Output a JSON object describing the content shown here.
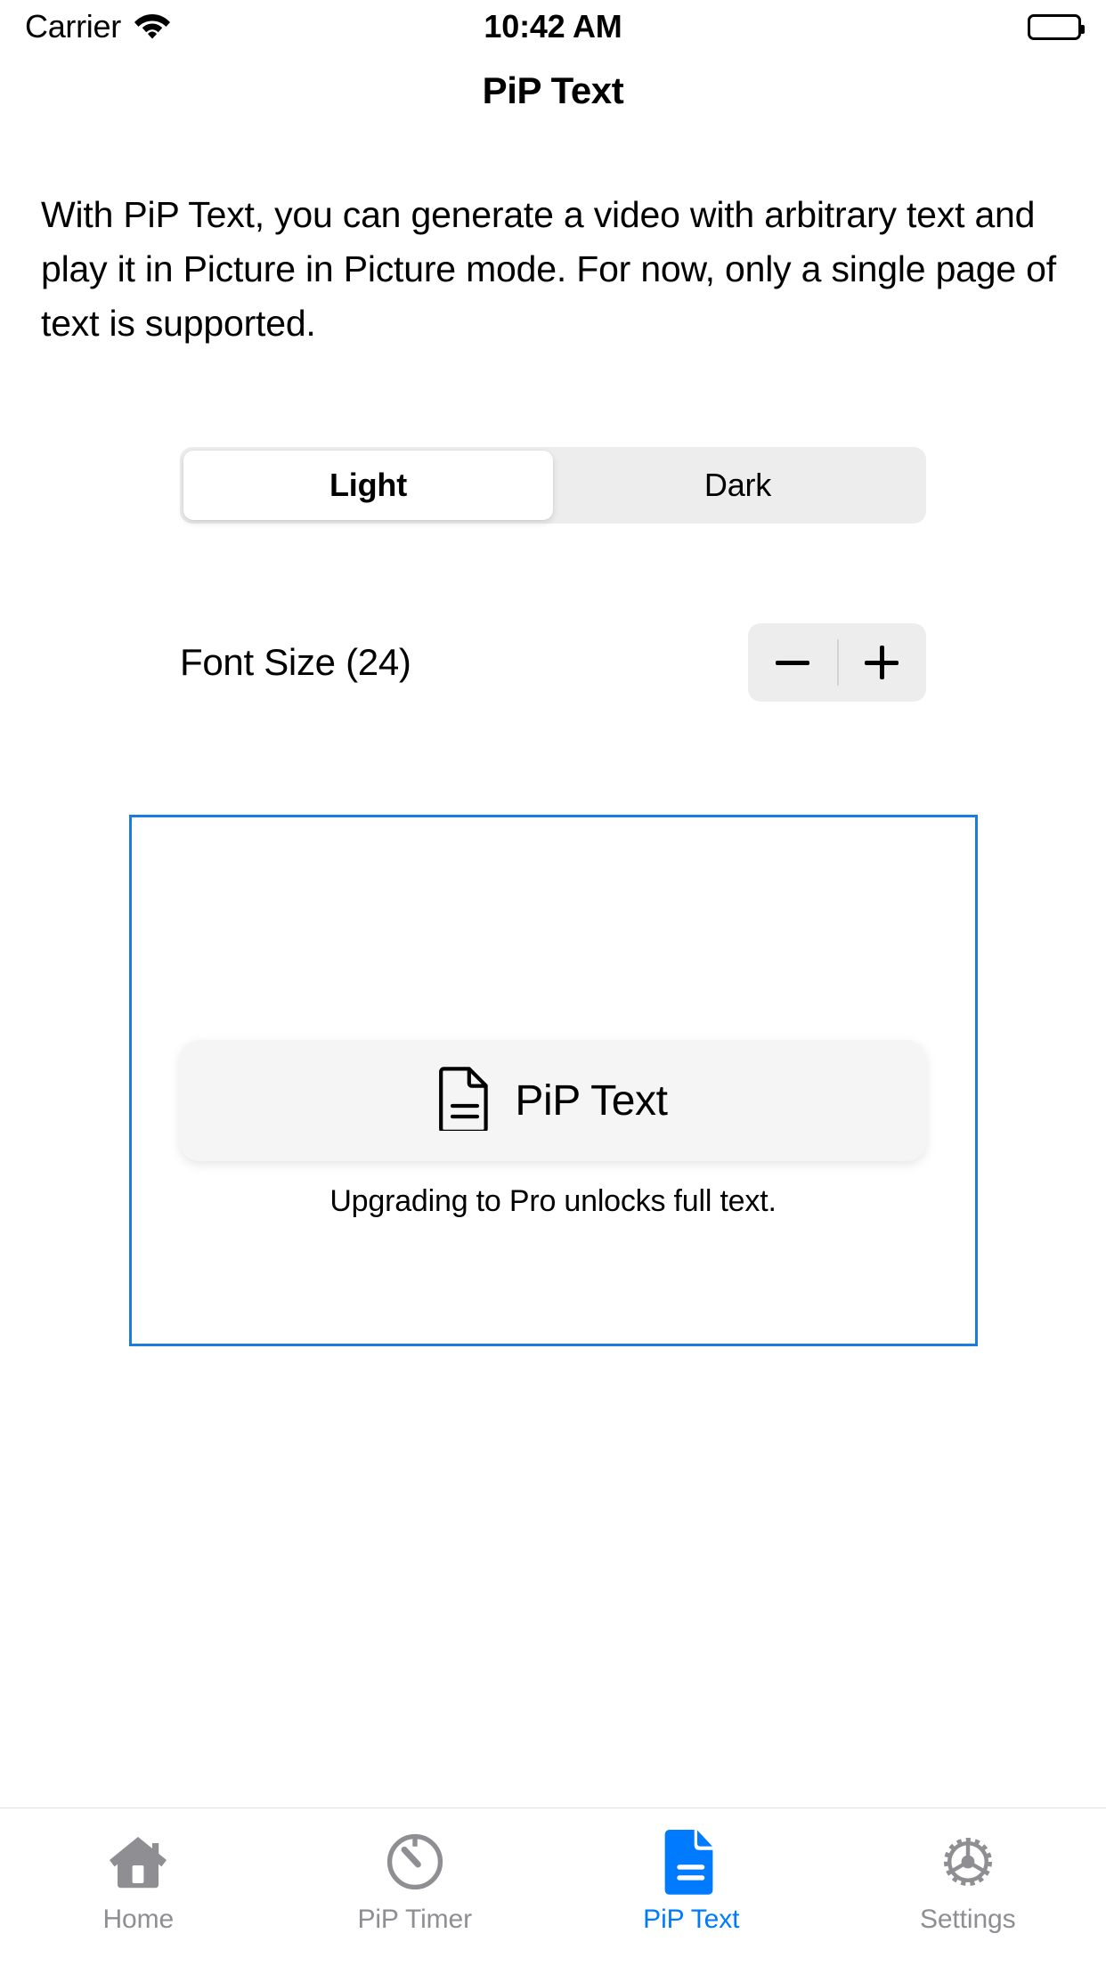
{
  "status_bar": {
    "carrier": "Carrier",
    "time": "10:42 AM",
    "wifi_icon": "wifi-icon",
    "battery_icon": "battery-full-icon"
  },
  "nav": {
    "title": "PiP Text"
  },
  "main": {
    "intro_paragraph": "With PiP Text, you can generate a video with arbitrary text and play it in Picture in Picture mode. For now, only a single page of text is supported.",
    "appearance_segmented": {
      "options": [
        {
          "label": "Light",
          "selected": true
        },
        {
          "label": "Dark",
          "selected": false
        }
      ]
    },
    "font_size": {
      "label": "Font Size (24)",
      "value": 24,
      "decrement_icon": "minus-icon",
      "increment_icon": "plus-icon"
    },
    "text_editor": {
      "value": "",
      "placeholder": "",
      "border_color": "#1a7ce0"
    },
    "primary_button": {
      "label": "PiP Text",
      "icon": "document-text-icon"
    },
    "pro_caption": "Upgrading to Pro unlocks full text."
  },
  "tab_bar": {
    "active_color": "#007aff",
    "inactive_color": "#8e8e93",
    "items": [
      {
        "label": "Home",
        "icon": "house-icon",
        "active": false
      },
      {
        "label": "PiP Timer",
        "icon": "timer-icon",
        "active": false
      },
      {
        "label": "PiP Text",
        "icon": "document-text-fill-icon",
        "active": true
      },
      {
        "label": "Settings",
        "icon": "gear-icon",
        "active": false
      }
    ]
  }
}
